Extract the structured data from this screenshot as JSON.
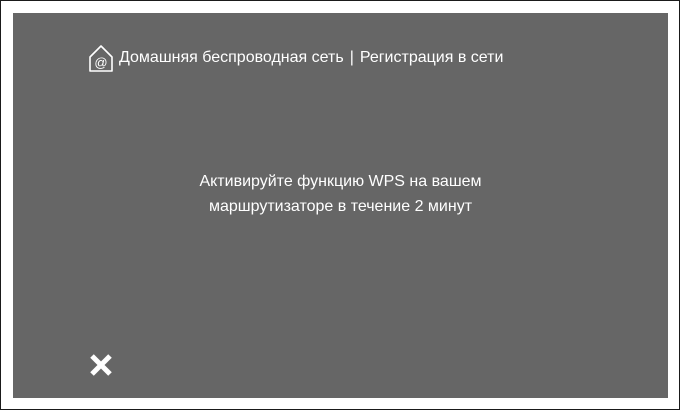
{
  "header": {
    "icon": "home-wifi-icon",
    "title": "Домашняя беспроводная сеть",
    "separator": "|",
    "subtitle": "Регистрация в сети"
  },
  "message": {
    "line1": "Активируйте функцию WPS на вашем",
    "line2": "маршрутизаторе в течение 2 минут"
  },
  "controls": {
    "close_icon": "close-icon"
  },
  "colors": {
    "screen_background": "#666666",
    "text": "#ffffff"
  }
}
